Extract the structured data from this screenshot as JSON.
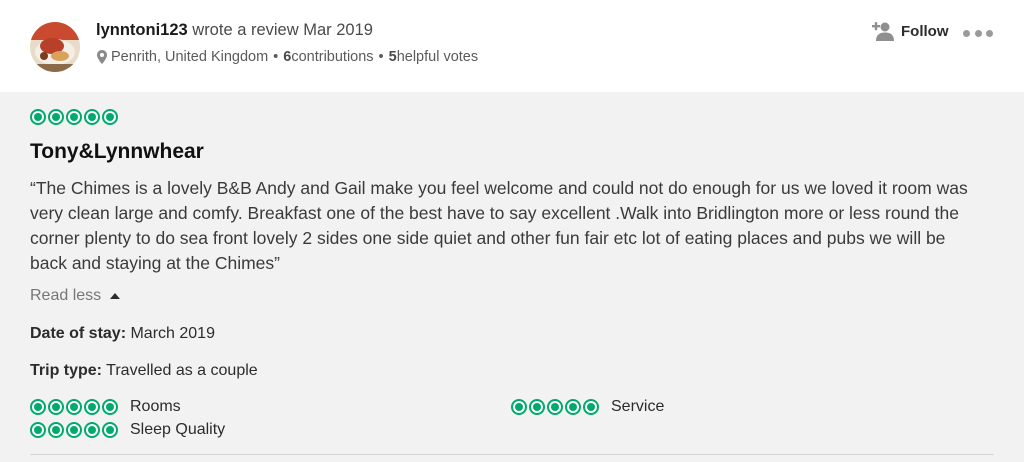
{
  "header": {
    "username": "lynntoni123",
    "action_text": " wrote a review Mar 2019",
    "location": "Penrith, United Kingdom",
    "contributions_count": "6",
    "contributions_label": " contributions",
    "helpful_count": "5",
    "helpful_label": " helpful votes",
    "separator": "•",
    "follow_label": "Follow"
  },
  "review": {
    "rating": 5,
    "title": "Tony&Lynnwhear",
    "text": "“The Chimes is a lovely B&B Andy and Gail make you feel welcome and could not do enough for us we loved it room was very clean large and comfy. Breakfast one of the best have to say excellent .Walk into Bridlington more or less round the corner plenty to do sea front lovely 2 sides one side quiet and other fun fair etc lot of eating places and pubs we will be back and staying at the Chimes”",
    "read_less_label": "Read less",
    "date_of_stay_label": "Date of stay:",
    "date_of_stay_value": " March 2019",
    "trip_type_label": "Trip type:",
    "trip_type_value": " Travelled as a couple",
    "sub_ratings": [
      {
        "label": "Rooms",
        "rating": 5
      },
      {
        "label": "Sleep Quality",
        "rating": 5
      },
      {
        "label": "Service",
        "rating": 5
      }
    ]
  },
  "colors": {
    "bubble_green": "#00aa6c",
    "body_background": "#f2f2f2"
  },
  "icons": {
    "location": "map-pin-icon",
    "follow": "add-user-icon",
    "more": "more-options-icon",
    "rating": "rating-bubble-icon",
    "read_less": "caret-up-icon"
  }
}
